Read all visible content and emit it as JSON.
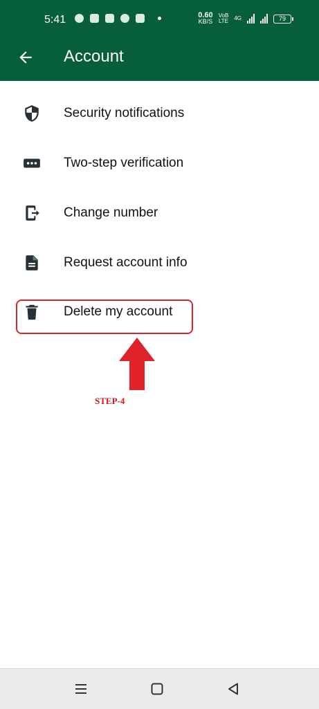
{
  "status_bar": {
    "time": "5:41",
    "network_speed_value": "0.60",
    "network_speed_unit": "KB/S",
    "volte": "VoB",
    "lte": "LTE",
    "signal_label": "4G",
    "battery": "79"
  },
  "app_bar": {
    "title": "Account"
  },
  "menu": {
    "items": [
      {
        "label": "Security notifications",
        "icon": "shield-icon"
      },
      {
        "label": "Two-step verification",
        "icon": "password-dots-icon"
      },
      {
        "label": "Change number",
        "icon": "change-number-icon"
      },
      {
        "label": "Request account info",
        "icon": "document-icon"
      },
      {
        "label": "Delete my account",
        "icon": "trash-icon"
      }
    ]
  },
  "annotation": {
    "step_label": "STEP-4",
    "highlight_color": "#e0222a"
  },
  "colors": {
    "header": "#075e3a",
    "icon": "#37474f"
  }
}
